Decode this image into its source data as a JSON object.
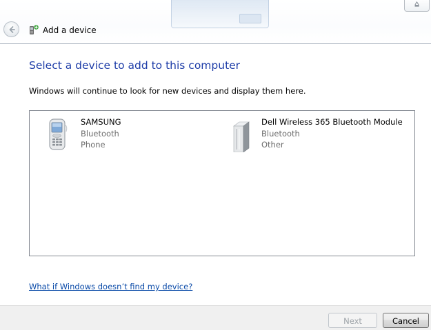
{
  "window": {
    "title": "Add a device",
    "system_button_glyph": "⩠"
  },
  "main": {
    "heading": "Select a device to add to this computer",
    "info": "Windows will continue to look for new devices and display them here."
  },
  "devices": [
    {
      "name": "SAMSUNG",
      "connection": "Bluetooth",
      "category": "Phone",
      "icon": "mobile-phone-icon"
    },
    {
      "name": "Dell Wireless 365 Bluetooth Module",
      "connection": "Bluetooth",
      "category": "Other",
      "icon": "generic-device-icon"
    }
  ],
  "help": {
    "link_text": "What if Windows doesn’t find my device?"
  },
  "buttons": {
    "next_label": "Next",
    "cancel_label": "Cancel"
  },
  "colors": {
    "heading_blue": "#1e3da8",
    "link_blue": "#0a4aa8",
    "footer_gray": "#f0f0f0"
  }
}
